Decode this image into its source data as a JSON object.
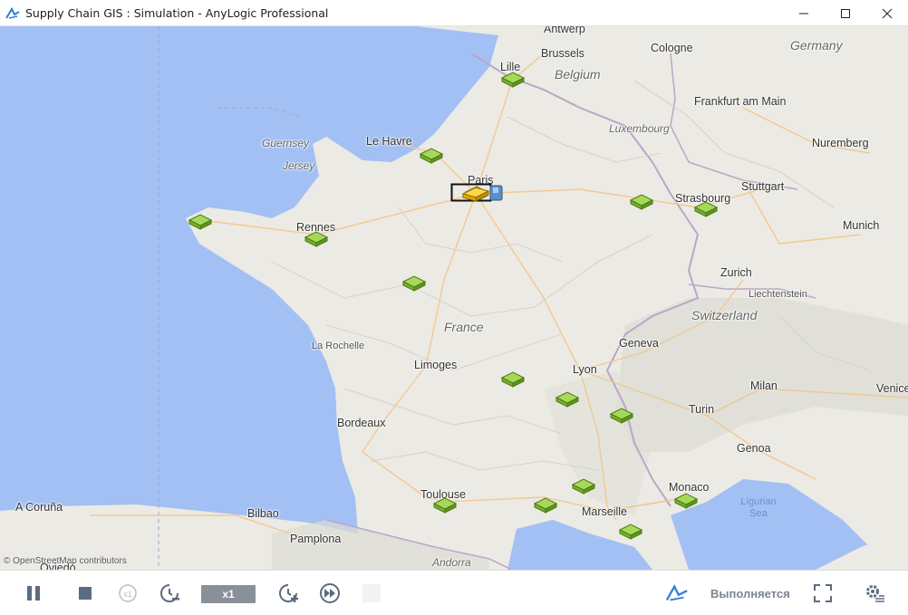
{
  "window": {
    "title": "Supply Chain GIS : Simulation - AnyLogic Professional"
  },
  "map": {
    "countries": [
      "Germany",
      "Belgium",
      "France",
      "Switzerland"
    ],
    "cities": [
      "Antwerp",
      "Cologne",
      "Brussels",
      "Lille",
      "Frankfurt am Main",
      "Luxembourg",
      "Le Havre",
      "Nuremberg",
      "Paris",
      "Stuttgart",
      "Strasbourg",
      "Rennes",
      "Munich",
      "Zurich",
      "Geneva",
      "La Rochelle",
      "Limoges",
      "Lyon",
      "Milan",
      "Venice",
      "Bordeaux",
      "Turin",
      "Genoa",
      "Toulouse",
      "Monaco",
      "A Coruña",
      "Bilbao",
      "Marseille",
      "Pamplona",
      "Andorra",
      "Oviedo"
    ],
    "regions": [
      "Guernsey",
      "Jersey",
      "Liechtenstein"
    ],
    "sea": "Ligurian Sea",
    "credit": "© OpenStreetMap contributors",
    "warehouse_count": 16,
    "truck_count": 1
  },
  "controls": {
    "speed": "x1",
    "status": "Выполняется"
  },
  "colors": {
    "water": "#a3c0f4",
    "land": "#eceae4",
    "warehouse": "#8cc63f",
    "truck": "#f2b705",
    "status_text": "#7b8493"
  }
}
